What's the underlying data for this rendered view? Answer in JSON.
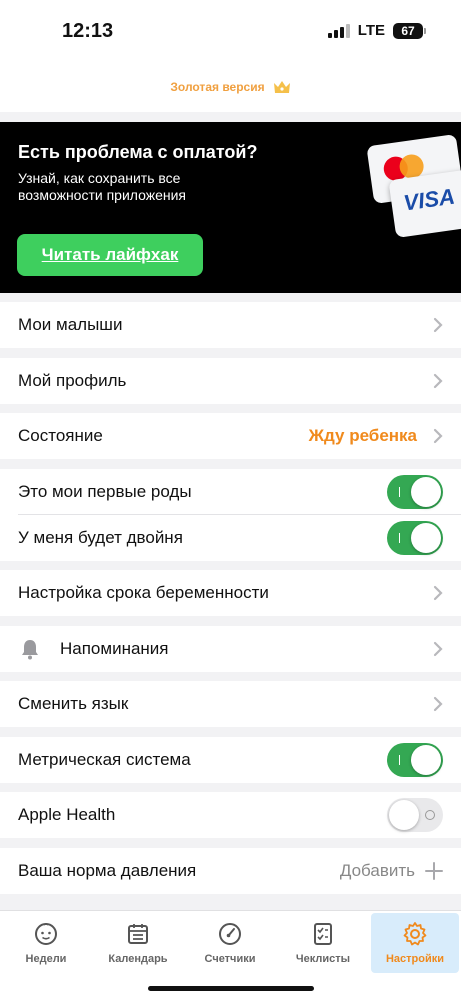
{
  "status_bar": {
    "time": "12:13",
    "network": "LTE",
    "battery": "67"
  },
  "header": {
    "gold_label": "Золотая версия",
    "icon": "crown-icon"
  },
  "promo": {
    "title": "Есть проблема с оплатой?",
    "text": "Узнай, как сохранить все возможности приложения",
    "button_label": "Читать лайфхак",
    "card_brand": "VISA"
  },
  "settings": {
    "my_babies": "Мои малыши",
    "my_profile": "Мой профиль",
    "state_label": "Состояние",
    "state_value": "Жду ребенка",
    "first_birth": "Это мои первые роды",
    "first_birth_on": true,
    "twins": "У меня будет двойня",
    "twins_on": true,
    "pregnancy_term": "Настройка срока беременности",
    "reminders": "Напоминания",
    "change_language": "Сменить язык",
    "metric_system": "Метрическая система",
    "metric_on": true,
    "apple_health": "Apple Health",
    "apple_health_on": false,
    "pressure_norm": "Ваша норма давления",
    "pressure_action": "Добавить"
  },
  "tabbar": {
    "tabs": [
      {
        "label": "Недели",
        "icon": "baby-face-icon"
      },
      {
        "label": "Календарь",
        "icon": "calendar-icon"
      },
      {
        "label": "Счетчики",
        "icon": "counter-icon"
      },
      {
        "label": "Чеклисты",
        "icon": "checklist-icon"
      },
      {
        "label": "Настройки",
        "icon": "gear-icon",
        "active": true
      }
    ]
  },
  "colors": {
    "accent_orange": "#f08a1d",
    "toggle_green": "#34a853",
    "promo_button": "#3ecf5e",
    "gold": "#f0a040"
  }
}
